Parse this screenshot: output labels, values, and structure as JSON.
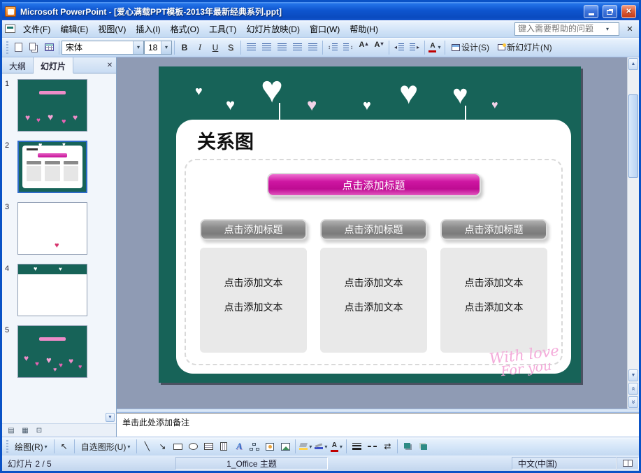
{
  "window": {
    "title": "Microsoft PowerPoint - [爱心满载PPT模板-2013年最新经典系列.ppt]"
  },
  "menu": {
    "items": [
      "文件(F)",
      "编辑(E)",
      "视图(V)",
      "插入(I)",
      "格式(O)",
      "工具(T)",
      "幻灯片放映(D)",
      "窗口(W)",
      "帮助(H)"
    ],
    "help_placeholder": "键入需要帮助的问题"
  },
  "toolbar": {
    "font_name": "宋体",
    "font_size": "18",
    "bold": "B",
    "italic": "I",
    "underline": "U",
    "shadow": "S",
    "design_label": "设计(S)",
    "new_slide_label": "新幻灯片(N)"
  },
  "panel": {
    "tabs": [
      "大纲",
      "幻灯片"
    ],
    "slides": [
      "1",
      "2",
      "3",
      "4",
      "5"
    ]
  },
  "slide": {
    "title": "关系图",
    "top_button": "点击添加标题",
    "columns": [
      {
        "header": "点击添加标题",
        "lines": [
          "点击添加文本",
          "点击添加文本"
        ]
      },
      {
        "header": "点击添加标题",
        "lines": [
          "点击添加文本",
          "点击添加文本"
        ]
      },
      {
        "header": "点击添加标题",
        "lines": [
          "点击添加文本",
          "点击添加文本"
        ]
      }
    ],
    "watermark": [
      "With love",
      "For you"
    ]
  },
  "notes": {
    "placeholder": "单击此处添加备注"
  },
  "drawing": {
    "draw_label": "绘图(R)",
    "autoshapes_label": "自选图形(U)"
  },
  "statusbar": {
    "slide_info": "幻灯片 2 / 5",
    "theme": "1_Office 主题",
    "language": "中文(中国)"
  },
  "icons": {
    "close": "✕",
    "heart": "♥",
    "caret_down": "▾",
    "caret_up": "▴",
    "up": "▲",
    "down": "▼",
    "left": "◂",
    "right": "▸",
    "chevron": "«",
    "updown": "↕",
    "select": "↖",
    "line": "╲",
    "arrow": "↘",
    "arrows": "⇄",
    "letter_a": "A",
    "view_normal": "▤",
    "view_sorter": "▦",
    "view_show": "⊡"
  },
  "colors": {
    "slide_background": "#176358",
    "accent_pink": "#C9119A",
    "header_gray": "#8A8A8A",
    "titlebar_blue": "#0E55CF"
  }
}
